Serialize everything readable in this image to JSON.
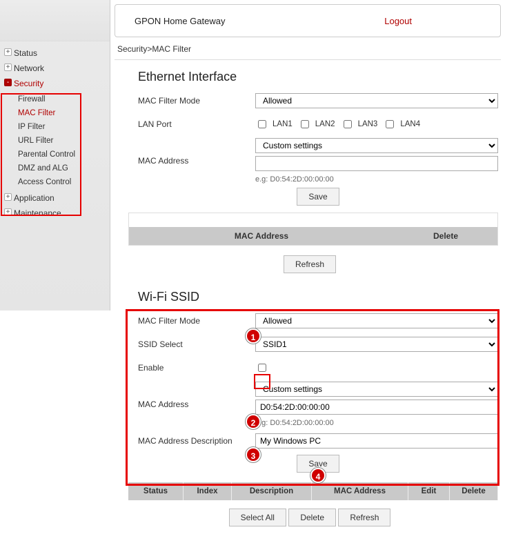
{
  "header": {
    "title": "GPON Home Gateway",
    "logout": "Logout"
  },
  "breadcrumb": "Security>MAC Filter",
  "sidebar": {
    "items": [
      {
        "label": "Status"
      },
      {
        "label": "Network"
      },
      {
        "label": "Security",
        "active": true,
        "children": [
          {
            "label": "Firewall"
          },
          {
            "label": "MAC Filter",
            "active": true
          },
          {
            "label": "IP Filter"
          },
          {
            "label": "URL Filter"
          },
          {
            "label": "Parental Control"
          },
          {
            "label": "DMZ and ALG"
          },
          {
            "label": "Access Control"
          }
        ]
      },
      {
        "label": "Application"
      },
      {
        "label": "Maintenance"
      }
    ]
  },
  "eth": {
    "title": "Ethernet Interface",
    "mode_label": "MAC Filter Mode",
    "mode_value": "Allowed",
    "lan_label": "LAN Port",
    "lan_ports": [
      "LAN1",
      "LAN2",
      "LAN3",
      "LAN4"
    ],
    "mac_label": "MAC Address",
    "mac_select": "Custom settings",
    "mac_input": "",
    "mac_hint": "e.g: D0:54:2D:00:00:00",
    "save": "Save",
    "table_head": {
      "mac": "MAC Address",
      "del": "Delete"
    },
    "refresh": "Refresh"
  },
  "wifi": {
    "title": "Wi-Fi SSID",
    "mode_label": "MAC Filter Mode",
    "mode_value": "Allowed",
    "ssid_label": "SSID Select",
    "ssid_value": "SSID1",
    "enable_label": "Enable",
    "enable_checked": false,
    "mac_label": "MAC Address",
    "mac_select": "Custom settings",
    "mac_input": "D0:54:2D:00:00:00",
    "mac_hint": "e.g: D0:54:2D:00:00:00",
    "desc_label": "MAC Address Description",
    "desc_value": "My Windows PC",
    "save": "Save",
    "table_head": {
      "status": "Status",
      "index": "Index",
      "desc": "Description",
      "mac": "MAC Address",
      "edit": "Edit",
      "del": "Delete"
    },
    "buttons": {
      "select_all": "Select All",
      "delete": "Delete",
      "refresh": "Refresh"
    }
  },
  "badges": [
    "1",
    "2",
    "3",
    "4"
  ]
}
